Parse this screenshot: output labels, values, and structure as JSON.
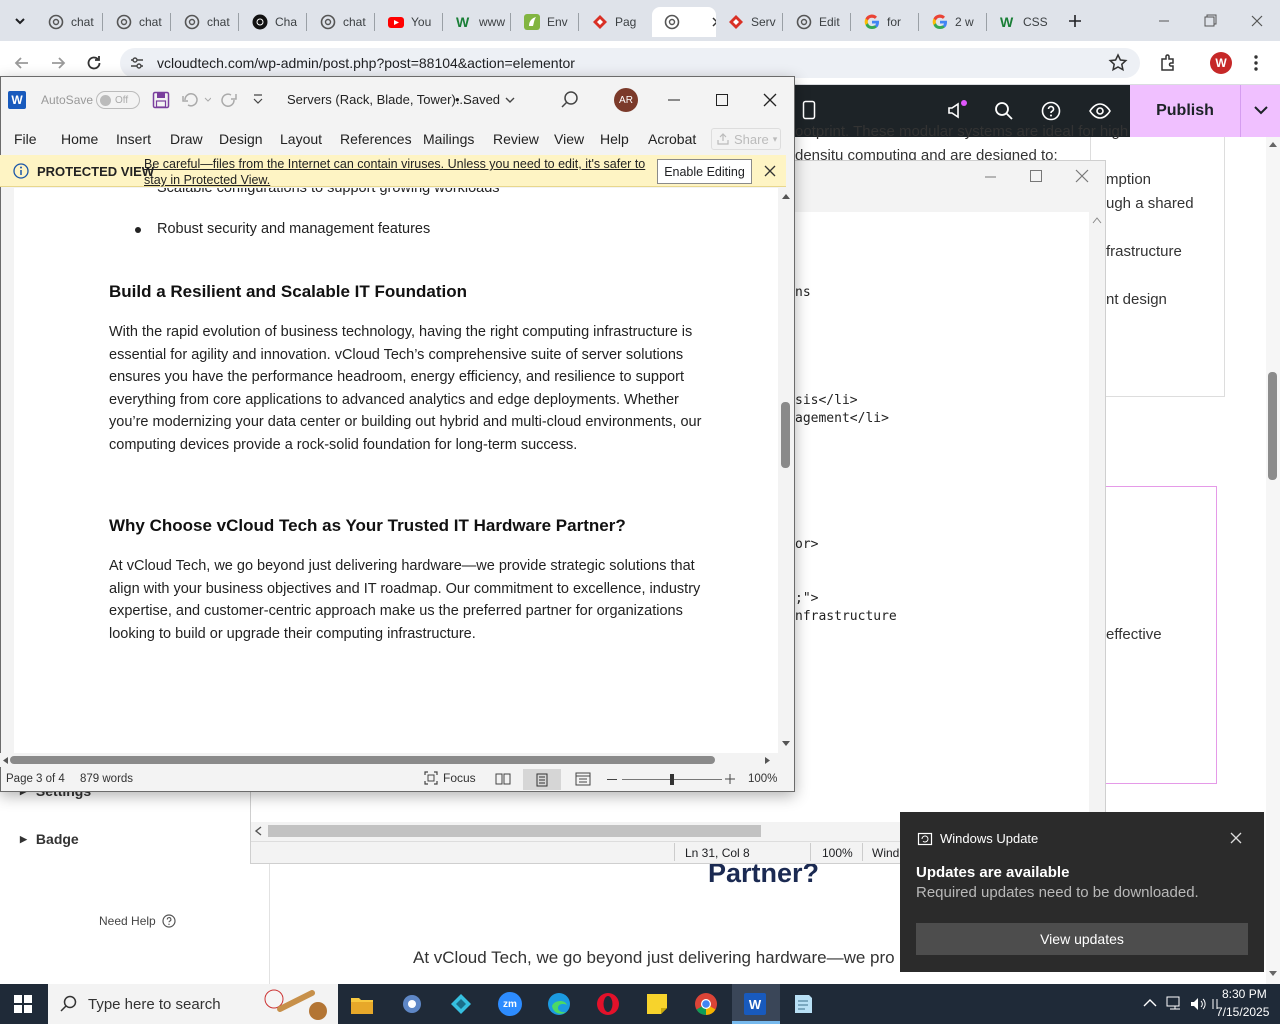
{
  "browser": {
    "tabs": [
      {
        "label": "chat",
        "icon": "openai-icon"
      },
      {
        "label": "chat",
        "icon": "openai-icon"
      },
      {
        "label": "chat",
        "icon": "openai-icon"
      },
      {
        "label": "Cha",
        "icon": "chatgpt-icon"
      },
      {
        "label": "chat",
        "icon": "openai-icon"
      },
      {
        "label": "You",
        "icon": "youtube-icon"
      },
      {
        "label": "www",
        "icon": "w-icon"
      },
      {
        "label": "Env",
        "icon": "envato-icon"
      },
      {
        "label": "Pag",
        "icon": "diamond-icon"
      },
      {
        "label": "",
        "icon": "openai-icon"
      },
      {
        "label": "Serv",
        "icon": "diamond-icon"
      },
      {
        "label": "Edit",
        "icon": "openai-icon"
      },
      {
        "label": "for",
        "icon": "google-icon"
      },
      {
        "label": "2 w",
        "icon": "google-icon"
      },
      {
        "label": "CSS",
        "icon": "w-icon"
      }
    ],
    "url": "vcloudtech.com/wp-admin/post.php?post=88104&action=elementor",
    "profile_initial": "W"
  },
  "wordpress": {
    "publish_label": "Publish",
    "sidebar_items": [
      "Settings",
      "Badge"
    ],
    "need_help": "Need Help",
    "right_text": [
      "ootprint. These modular systems are ideal for high",
      "densitu computing and are designed to:",
      "mption",
      "ugh a shared",
      "frastructure",
      "nt design",
      "effective"
    ],
    "heading": "Partner?",
    "body": "At vCloud Tech, we go beyond just delivering hardware—we pro"
  },
  "code_window": {
    "lines": [
      "ns",
      "sis</li>",
      "agement</li>",
      "or>",
      ";\">",
      "nfrastructure"
    ],
    "status": {
      "position": "Ln 31, Col 8",
      "zoom": "100%",
      "encoding": "Wind"
    }
  },
  "word": {
    "autosave_label": "AutoSave",
    "autosave_state": "Off",
    "title": "Servers (Rack, Blade, Tower)...",
    "saved_label": "• Saved",
    "avatar": "AR",
    "menu": [
      "File",
      "Home",
      "Insert",
      "Draw",
      "Design",
      "Layout",
      "References",
      "Mailings",
      "Review",
      "View",
      "Help",
      "Acrobat"
    ],
    "share_label": "Share",
    "protected": {
      "label": "PROTECTED VIEW",
      "message": "Be careful—files from the Internet can contain viruses. Unless you need to edit, it's safer to stay in Protected View.",
      "button": "Enable Editing"
    },
    "doc": {
      "clipped_bullet": "Scalable configurations to support growing workloads",
      "bullet": "Robust security and management features",
      "heading1": "Build a Resilient and Scalable IT Foundation",
      "para1": "With the rapid evolution of business technology, having the right computing infrastructure is essential for agility and innovation. vCloud Tech’s comprehensive suite of server solutions ensures you have the performance headroom, energy efficiency, and resilience to support everything from core applications to advanced analytics and edge deployments. Whether you’re modernizing your data center or building out hybrid and multi-cloud environments, our computing devices provide a rock-solid foundation for long-term success.",
      "heading2": "Why Choose vCloud Tech as Your Trusted IT Hardware Partner?",
      "para2": "At vCloud Tech, we go beyond just delivering hardware—we provide strategic solutions that align with your business objectives and IT roadmap. Our commitment to excellence, industry expertise, and customer-centric approach make us the preferred partner for organizations looking to build or upgrade their computing infrastructure."
    },
    "status": {
      "page": "Page 3 of 4",
      "words": "879 words",
      "focus": "Focus",
      "zoom": "100%",
      "zoom_level": 0.5
    }
  },
  "notification": {
    "app": "Windows Update",
    "title": "Updates are available",
    "body": "Required updates need to be downloaded.",
    "button": "View updates"
  },
  "taskbar": {
    "search_placeholder": "Type here to search",
    "time": "8:30 PM",
    "date": "7/15/2025"
  }
}
